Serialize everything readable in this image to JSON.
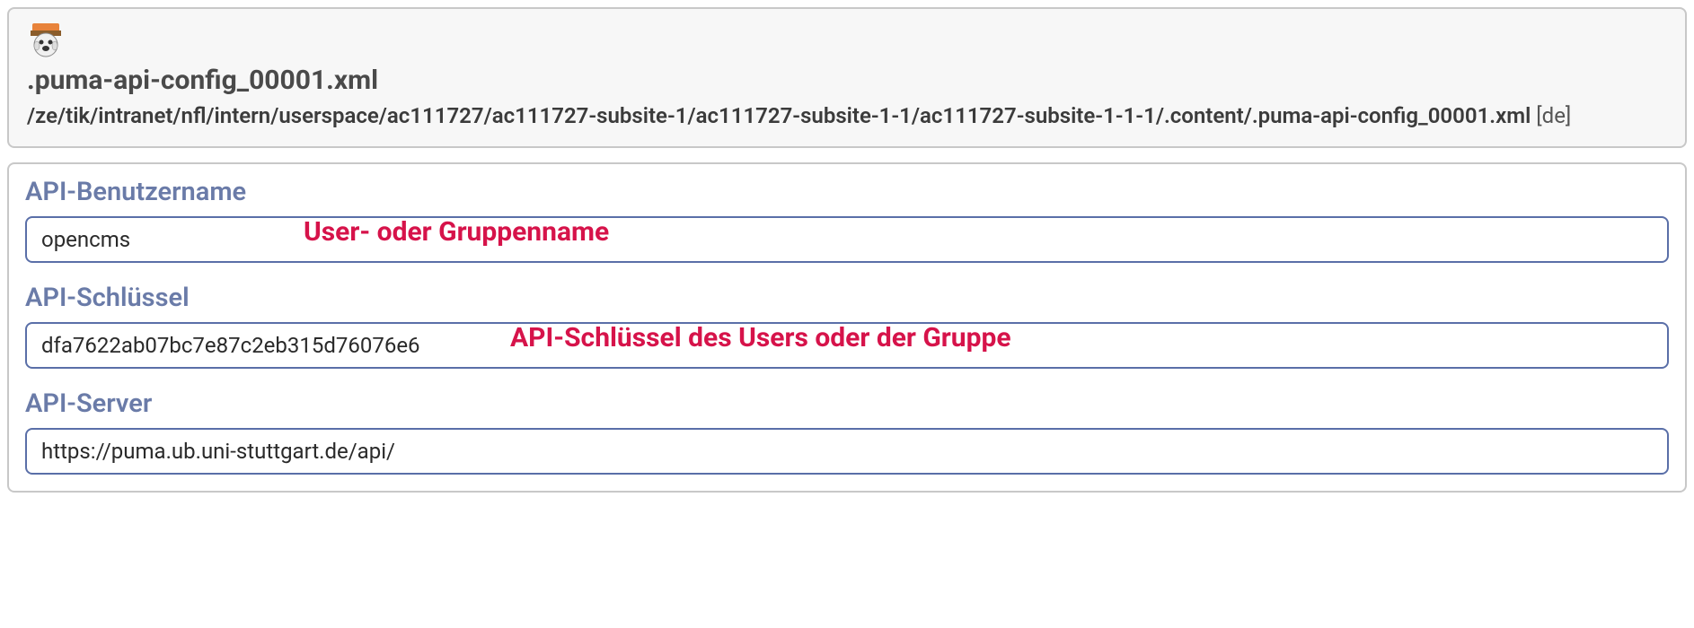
{
  "header": {
    "icon_name": "file-type-icon",
    "title": ".puma-api-config_00001.xml",
    "path": "/ze/tik/intranet/nfl/intern/userspace/ac111727/ac111727-subsite-1/ac111727-subsite-1-1/ac111727-subsite-1-1-1/.content/.puma-api-config_00001.xml",
    "locale": "[de]"
  },
  "fields": {
    "username": {
      "label": "API-Benutzername",
      "value": "opencms",
      "annotation": "User- oder Gruppenname"
    },
    "apikey": {
      "label": "API-Schlüssel",
      "value": "dfa7622ab07bc7e87c2eb315d76076e6",
      "annotation": "API-Schlüssel des Users oder der Gruppe"
    },
    "apiserver": {
      "label": "API-Server",
      "value": "https://puma.ub.uni-stuttgart.de/api/"
    }
  }
}
